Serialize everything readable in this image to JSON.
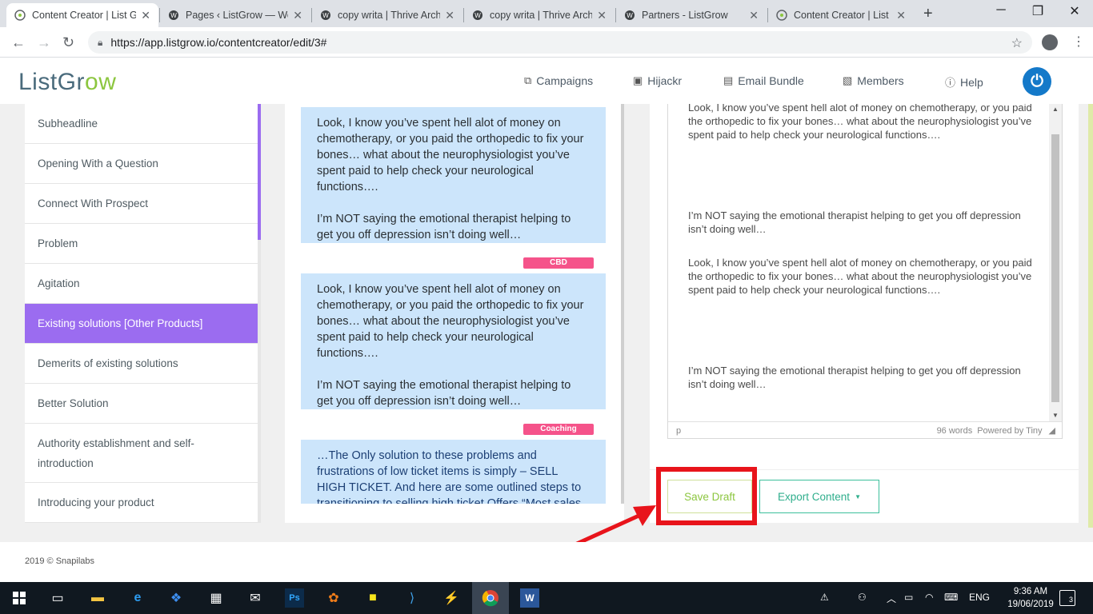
{
  "browser": {
    "tabs": [
      {
        "title": "Content Creator | List G",
        "active": true
      },
      {
        "title": "Pages ‹ ListGrow — Wo",
        "active": false
      },
      {
        "title": "copy writa | Thrive Arch",
        "active": false
      },
      {
        "title": "copy writa | Thrive Arch",
        "active": false
      },
      {
        "title": "Partners - ListGrow",
        "active": false
      },
      {
        "title": "Content Creator | List G",
        "active": false
      }
    ],
    "url": "https://app.listgrow.io/contentcreator/edit/3#"
  },
  "app": {
    "logo_main": "ListGr",
    "logo_accent": "ow",
    "nav": [
      {
        "label": "Campaigns",
        "icon": "campaigns-icon"
      },
      {
        "label": "Hijackr",
        "icon": "hijackr-icon"
      },
      {
        "label": "Email Bundle",
        "icon": "email-bundle-icon"
      },
      {
        "label": "Members",
        "icon": "members-icon"
      },
      {
        "label": "Help",
        "icon": "help-icon"
      }
    ]
  },
  "sidebar": {
    "items": [
      {
        "label": "Subheadline"
      },
      {
        "label": "Opening With a Question"
      },
      {
        "label": "Connect With Prospect"
      },
      {
        "label": "Problem"
      },
      {
        "label": "Agitation"
      },
      {
        "label": "Existing solutions [Other Products]"
      },
      {
        "label": "Demerits of existing solutions"
      },
      {
        "label": "Better Solution"
      },
      {
        "label": "Authority establishment and self-introduction"
      },
      {
        "label": "Introducing your product"
      }
    ],
    "active_index": 5
  },
  "middle": {
    "bubbles": [
      {
        "p1": "Look, I know you’ve spent hell alot of money on chemotherapy, or you paid the orthopedic to fix your bones… what about the neurophysiologist you’ve spent paid to help check your neurological functions….",
        "p2": "I’m NOT saying the emotional therapist helping to get you off depression isn’t doing well…"
      },
      {
        "tag": "CBD",
        "p1": "Look, I know you’ve spent hell alot of money on chemotherapy, or you paid the orthopedic to fix your bones… what about the neurophysiologist you’ve spent paid to help check your neurological functions….",
        "p2": "I’m NOT saying the emotional therapist helping to get you off depression isn’t doing well…"
      },
      {
        "tag": "Coaching",
        "p1": "…The Only solution to these problems and frustrations of low ticket items is simply – SELL HIGH TICKET. And here are some outlined steps to transitioning to selling high ticket Offers “Most sales"
      }
    ]
  },
  "editor": {
    "paragraphs": [
      "Look, I know you’ve spent hell alot of money on chemotherapy, or you paid the orthopedic to fix your bones… what about the neurophysiologist you’ve spent paid to help check your neurological functions….",
      "I’m NOT saying the emotional therapist helping to get you off depression isn’t doing well…",
      "Look, I know you’ve spent hell alot of money on chemotherapy, or you paid the orthopedic to fix your bones… what about the neurophysiologist you’ve spent paid to help check your neurological functions….",
      "I’m NOT saying the emotional therapist helping to get you off depression isn’t doing well…"
    ],
    "status_path": "p",
    "word_count": "96 words",
    "powered_by": "Powered by Tiny"
  },
  "actions": {
    "save_label": "Save Draft",
    "export_label": "Export Content"
  },
  "footer": {
    "text": "2019 © Snapilabs"
  },
  "taskbar": {
    "language": "ENG",
    "time": "9:36 AM",
    "date": "19/06/2019",
    "notifications": "3"
  },
  "colors": {
    "sidebar_active": "#9b6cf0",
    "bubble_bg": "#cce5fb",
    "tag_bg": "#f5538a",
    "save_border": "#cfe09a",
    "export_border": "#3cbf9b",
    "highlight": "#e8141b"
  }
}
